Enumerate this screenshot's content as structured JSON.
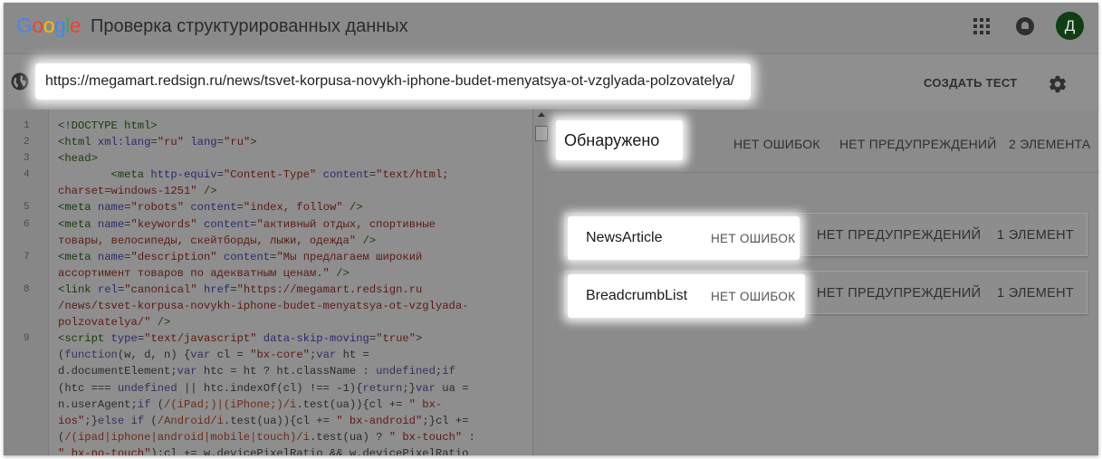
{
  "header": {
    "logo": {
      "letters": [
        "G",
        "o",
        "o",
        "g",
        "l",
        "e"
      ],
      "colors": [
        "#4285f4",
        "#ea4335",
        "#fbbc05",
        "#4285f4",
        "#34a853",
        "#ea4335"
      ]
    },
    "title": "Проверка структурированных данных",
    "avatar_letter": "Д",
    "avatar_color": "#0f3d14"
  },
  "toolbar": {
    "url": "https://megamart.redsign.ru/news/tsvet-korpusa-novykh-iphone-budet-menyatsya-ot-vzglyada-polzovatelya/",
    "create_test_label": "СОЗДАТЬ ТЕСТ"
  },
  "code": {
    "lines": [
      {
        "n": "1",
        "html": "<span class=\"tg\">&lt;!DOCTYPE html&gt;</span>"
      },
      {
        "n": "2",
        "html": "<span class=\"tg\">&lt;html</span> <span class=\"at\">xml:lang</span>=<span class=\"st\">\"ru\"</span> <span class=\"at\">lang</span>=<span class=\"st\">\"ru\"</span><span class=\"tg\">&gt;</span>"
      },
      {
        "n": "3",
        "html": "<span class=\"tg\">&lt;head&gt;</span>"
      },
      {
        "n": "4",
        "html": "        <span class=\"tg\">&lt;meta</span> <span class=\"at\">http-equiv</span>=<span class=\"st\">\"Content-Type\"</span> <span class=\"at\">content</span>=<span class=\"st\">\"text/html;\ncharset=windows-1251\"</span> <span class=\"tg\">/&gt;</span>"
      },
      {
        "n": "5",
        "html": "<span class=\"tg\">&lt;meta</span> <span class=\"at\">name</span>=<span class=\"st\">\"robots\"</span> <span class=\"at\">content</span>=<span class=\"st\">\"index, follow\"</span> <span class=\"tg\">/&gt;</span>"
      },
      {
        "n": "6",
        "html": "<span class=\"tg\">&lt;meta</span> <span class=\"at\">name</span>=<span class=\"st\">\"keywords\"</span> <span class=\"at\">content</span>=<span class=\"st\">\"активный отдых, спортивные\nтовары, велосипеды, скейтборды, лыжи, одежда\"</span> <span class=\"tg\">/&gt;</span>"
      },
      {
        "n": "7",
        "html": "<span class=\"tg\">&lt;meta</span> <span class=\"at\">name</span>=<span class=\"st\">\"description\"</span> <span class=\"at\">content</span>=<span class=\"st\">\"Мы предлагаем широкий\nассортимент товаров по адекватным ценам.\"</span> <span class=\"tg\">/&gt;</span>"
      },
      {
        "n": "8",
        "html": "<span class=\"tg\">&lt;link</span> <span class=\"at\">rel</span>=<span class=\"st\">\"canonical\"</span> <span class=\"at\">href</span>=<span class=\"st\">\"https://megamart.redsign.ru\n/news/tsvet-korpusa-novykh-iphone-budet-menyatsya-ot-vzglyada-\npolzovatelya/\"</span> <span class=\"tg\">/&gt;</span>"
      },
      {
        "n": "9",
        "html": "<span class=\"tg\">&lt;script</span> <span class=\"at\">type</span>=<span class=\"st\">\"text/javascript\"</span> <span class=\"at\">data-skip-moving</span>=<span class=\"st\">\"true\"</span><span class=\"tg\">&gt;</span>\n(<span class=\"kw\">function</span>(w, d, n) {<span class=\"kw\">var</span> cl = <span class=\"st\">\"bx-core\"</span>;<span class=\"kw\">var</span> ht =\nd.documentElement;<span class=\"kw\">var</span> htc = ht ? ht.className : <span class=\"kw\">undefined</span>;<span class=\"kw\">if</span>\n(htc === <span class=\"kw\">undefined</span> || htc.indexOf(cl) !== -1){<span class=\"kw\">return</span>;}<span class=\"kw\">var</span> ua =\nn.userAgent;<span class=\"kw\">if</span> (<span class=\"rx\">/(iPad;)|(iPhone;)/i</span>.test(ua)){cl += <span class=\"st\">\" bx-\nios\"</span>;}<span class=\"kw\">else if</span> (<span class=\"rx\">/Android/i</span>.test(ua)){cl += <span class=\"st\">\" bx-android\"</span>;}cl +=\n(<span class=\"rx\">/(ipad|iphone|android|mobile|touch)/i</span>.test(ua) ? <span class=\"st\">\" bx-touch\"</span> :\n<span class=\"st\">\" bx-no-touch\"</span>);cl += w.devicePixelRatio &amp;&amp; w.devicePixelRatio"
      }
    ]
  },
  "results": {
    "detected_label": "Обнаружено",
    "summary": {
      "errors": "НЕТ ОШИБОК",
      "warnings": "НЕТ ПРЕДУПРЕЖДЕНИЙ",
      "count": "2 ЭЛЕМЕНТА"
    },
    "items": [
      {
        "name": "NewsArticle",
        "errors": "НЕТ ОШИБОК",
        "warnings": "НЕТ ПРЕДУПРЕЖДЕНИЙ",
        "count": "1 ЭЛЕМЕНТ"
      },
      {
        "name": "BreadcrumbList",
        "errors": "НЕТ ОШИБОК",
        "warnings": "НЕТ ПРЕДУПРЕЖДЕНИЙ",
        "count": "1 ЭЛЕМЕНТ"
      }
    ]
  }
}
